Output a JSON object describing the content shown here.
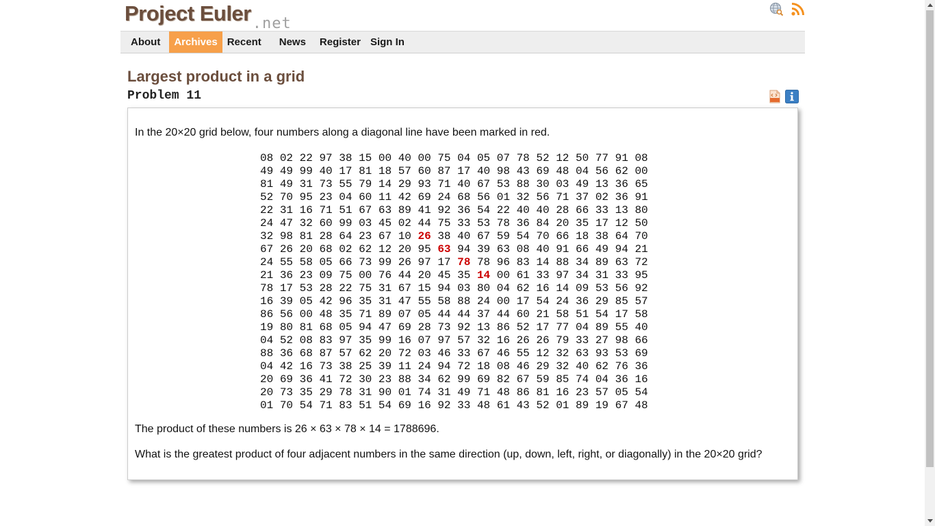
{
  "logo": {
    "main": "Project Euler",
    "net": ".net"
  },
  "top_icons": [
    "globe-search-icon",
    "rss-icon"
  ],
  "nav": {
    "items": [
      {
        "label": "About"
      },
      {
        "label": "Archives"
      },
      {
        "label": "Recent"
      },
      {
        "label": "News"
      },
      {
        "label": "Register"
      },
      {
        "label": "Sign In"
      }
    ],
    "active": "Archives",
    "accent": "#f7a04a"
  },
  "problem": {
    "title": "Largest product in a grid",
    "number": "Problem 11",
    "intro": "In the 20×20 grid below, four numbers along a diagonal line have been marked in red.",
    "product": "The product of these numbers is 26 × 63 × 78 × 14 = 1788696.",
    "question": "What is the greatest product of four adjacent numbers in the same direction (up, down, left, right, or diagonally) in the 20×20 grid?"
  },
  "grid": {
    "rows": [
      "08 02 22 97 38 15 00 40 00 75 04 05 07 78 52 12 50 77 91 08",
      "49 49 99 40 17 81 18 57 60 87 17 40 98 43 69 48 04 56 62 00",
      "81 49 31 73 55 79 14 29 93 71 40 67 53 88 30 03 49 13 36 65",
      "52 70 95 23 04 60 11 42 69 24 68 56 01 32 56 71 37 02 36 91",
      "22 31 16 71 51 67 63 89 41 92 36 54 22 40 40 28 66 33 13 80",
      "24 47 32 60 99 03 45 02 44 75 33 53 78 36 84 20 35 17 12 50",
      "32 98 81 28 64 23 67 10 26 38 40 67 59 54 70 66 18 38 64 70",
      "67 26 20 68 02 62 12 20 95 63 94 39 63 08 40 91 66 49 94 21",
      "24 55 58 05 66 73 99 26 97 17 78 78 96 83 14 88 34 89 63 72",
      "21 36 23 09 75 00 76 44 20 45 35 14 00 61 33 97 34 31 33 95",
      "78 17 53 28 22 75 31 67 15 94 03 80 04 62 16 14 09 53 56 92",
      "16 39 05 42 96 35 31 47 55 58 88 24 00 17 54 24 36 29 85 57",
      "86 56 00 48 35 71 89 07 05 44 44 37 44 60 21 58 51 54 17 58",
      "19 80 81 68 05 94 47 69 28 73 92 13 86 52 17 77 04 89 55 40",
      "04 52 08 83 97 35 99 16 07 97 57 32 16 26 26 79 33 27 98 66",
      "88 36 68 87 57 62 20 72 03 46 33 67 46 55 12 32 63 93 53 69",
      "04 42 16 73 38 25 39 11 24 94 72 18 08 46 29 32 40 62 76 36",
      "20 69 36 41 72 30 23 88 34 62 99 69 82 67 59 85 74 04 36 16",
      "20 73 35 29 78 31 90 01 74 31 49 71 48 86 81 16 23 57 05 54",
      "01 70 54 71 83 51 54 69 16 92 33 48 61 43 52 01 89 19 67 48"
    ],
    "highlighted": [
      [
        6,
        8
      ],
      [
        7,
        9
      ],
      [
        8,
        10
      ],
      [
        9,
        11
      ]
    ],
    "highlight_color": "#cc0000"
  },
  "info_icons": [
    "html-source-icon",
    "info-icon"
  ]
}
